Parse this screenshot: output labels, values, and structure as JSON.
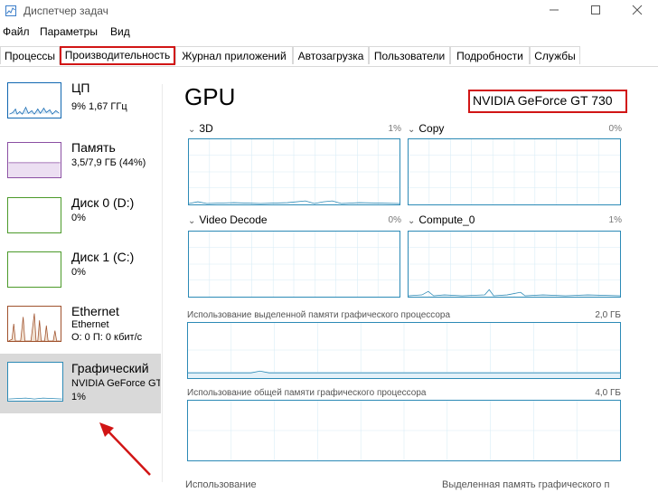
{
  "window": {
    "title": "Диспетчер задач"
  },
  "menu": [
    "Файл",
    "Параметры",
    "Вид"
  ],
  "tabs": [
    {
      "label": "Процессы",
      "active": false
    },
    {
      "label": "Производительность",
      "active": true
    },
    {
      "label": "Журнал приложений",
      "active": false
    },
    {
      "label": "Автозагрузка",
      "active": false
    },
    {
      "label": "Пользователи",
      "active": false
    },
    {
      "label": "Подробности",
      "active": false
    },
    {
      "label": "Службы",
      "active": false
    }
  ],
  "sidebar": [
    {
      "title": "ЦП",
      "sub1": "9% 1,67 ГГц",
      "sub2": "",
      "color": "#1167b1"
    },
    {
      "title": "Память",
      "sub1": "3,5/7,9 ГБ (44%)",
      "sub2": "",
      "color": "#8b4fa3"
    },
    {
      "title": "Диск 0 (D:)",
      "sub1": "0%",
      "sub2": "",
      "color": "#4c9a2a"
    },
    {
      "title": "Диск 1 (C:)",
      "sub1": "0%",
      "sub2": "",
      "color": "#4c9a2a"
    },
    {
      "title": "Ethernet",
      "sub1": "Ethernet",
      "sub2": "О: 0 П: 0 кбит/с",
      "color": "#a0522d"
    },
    {
      "title": "Графический",
      "sub1": "NVIDIA GeForce GT",
      "sub2": "1%",
      "color": "#2c8ab6"
    }
  ],
  "gpu": {
    "title": "GPU",
    "model": "NVIDIA GeForce GT 730",
    "engines": [
      {
        "name": "3D",
        "pct": "1%"
      },
      {
        "name": "Copy",
        "pct": "0%"
      },
      {
        "name": "Video Decode",
        "pct": "0%"
      },
      {
        "name": "Compute_0",
        "pct": "1%"
      }
    ],
    "dedicated": {
      "label": "Использование выделенной памяти графического процессора",
      "max": "2,0 ГБ"
    },
    "shared": {
      "label": "Использование общей памяти графического процессора",
      "max": "4,0 ГБ"
    },
    "bottom": {
      "left": "Использование",
      "right": "Выделенная память графического п"
    }
  }
}
